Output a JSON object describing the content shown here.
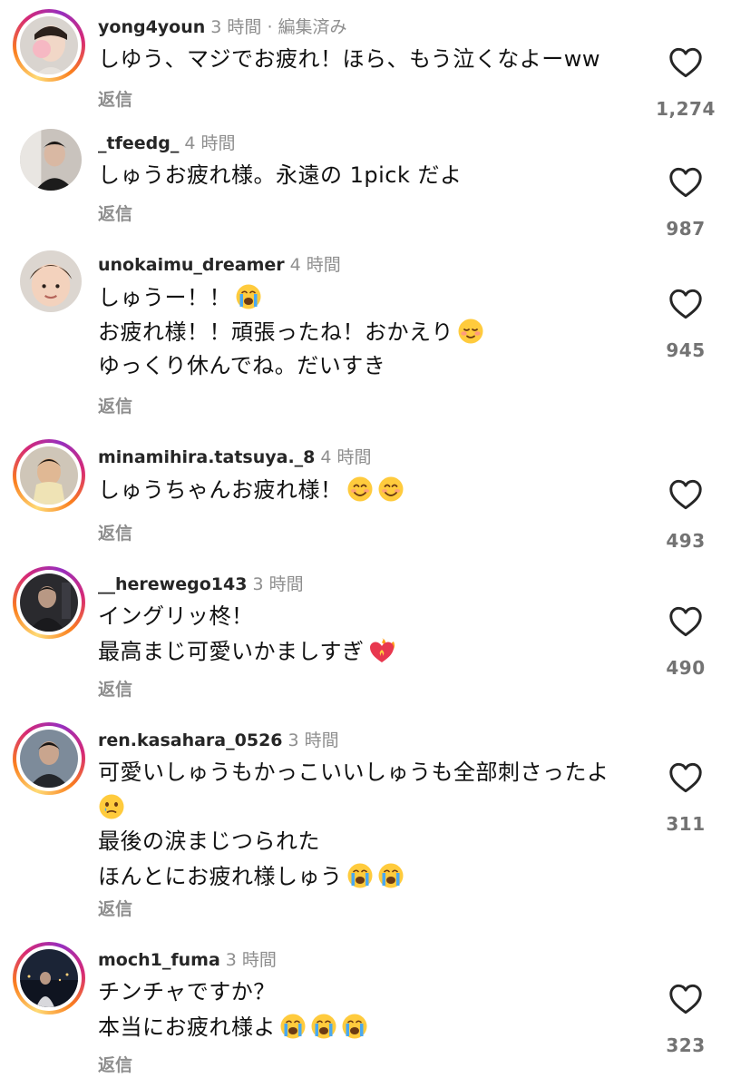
{
  "reply_label": "返信",
  "comments": [
    {
      "username": "yong4youn",
      "time": "3 時間 · 編集済み",
      "lines": [
        "しゆう、マジでお疲れ！ほら、もう泣くなよーww"
      ],
      "likes": "1,274",
      "has_ring": true
    },
    {
      "username": "_tfeedg_",
      "time": "4 時間",
      "lines": [
        "しゅうお疲れ様。永遠の 1pick だよ"
      ],
      "likes": "987",
      "has_ring": false
    },
    {
      "username": "unokaimu_dreamer",
      "time": "4 時間",
      "lines": [
        "しゅうー！！",
        "お疲れ様！！頑張ったね！おかえり",
        "ゆっくり休んでね。だいすき"
      ],
      "likes": "945",
      "has_ring": false
    },
    {
      "username": "minamihira.tatsuya._8",
      "time": "4 時間",
      "lines": [
        "しゅうちゃんお疲れ様！"
      ],
      "likes": "493",
      "has_ring": true
    },
    {
      "username": "__herewego143",
      "time": "3 時間",
      "lines": [
        "イングリッ柊！",
        "最高まじ可愛いかましすぎ"
      ],
      "likes": "490",
      "has_ring": true
    },
    {
      "username": "ren.kasahara_0526",
      "time": "3 時間",
      "lines": [
        "可愛いしゅうもかっこいいしゅうも全部刺さったよ",
        "",
        "最後の涙まじつられた",
        "ほんとにお疲れ様しゅう"
      ],
      "likes": "311",
      "has_ring": true
    },
    {
      "username": "moch1_fuma",
      "time": "3 時間",
      "lines": [
        "チンチャですか？",
        "本当にお疲れ様よ"
      ],
      "likes": "323",
      "has_ring": true
    }
  ],
  "icons": {
    "heart": "heart-outline-icon",
    "crying_emoji": "loudly-crying-face-emoji",
    "smiling_emoji": "smiling-face-emoji",
    "blush_emoji": "relieved-smile-emoji",
    "tear_emoji": "face-holding-back-tears-emoji",
    "heart_fire_emoji": "heart-on-fire-emoji"
  },
  "colors": {
    "username": "#262626",
    "secondary_text": "#8e8e8e",
    "like_count": "#737373",
    "story_ring_start": "#feda75",
    "story_ring_end": "#962fbf"
  }
}
